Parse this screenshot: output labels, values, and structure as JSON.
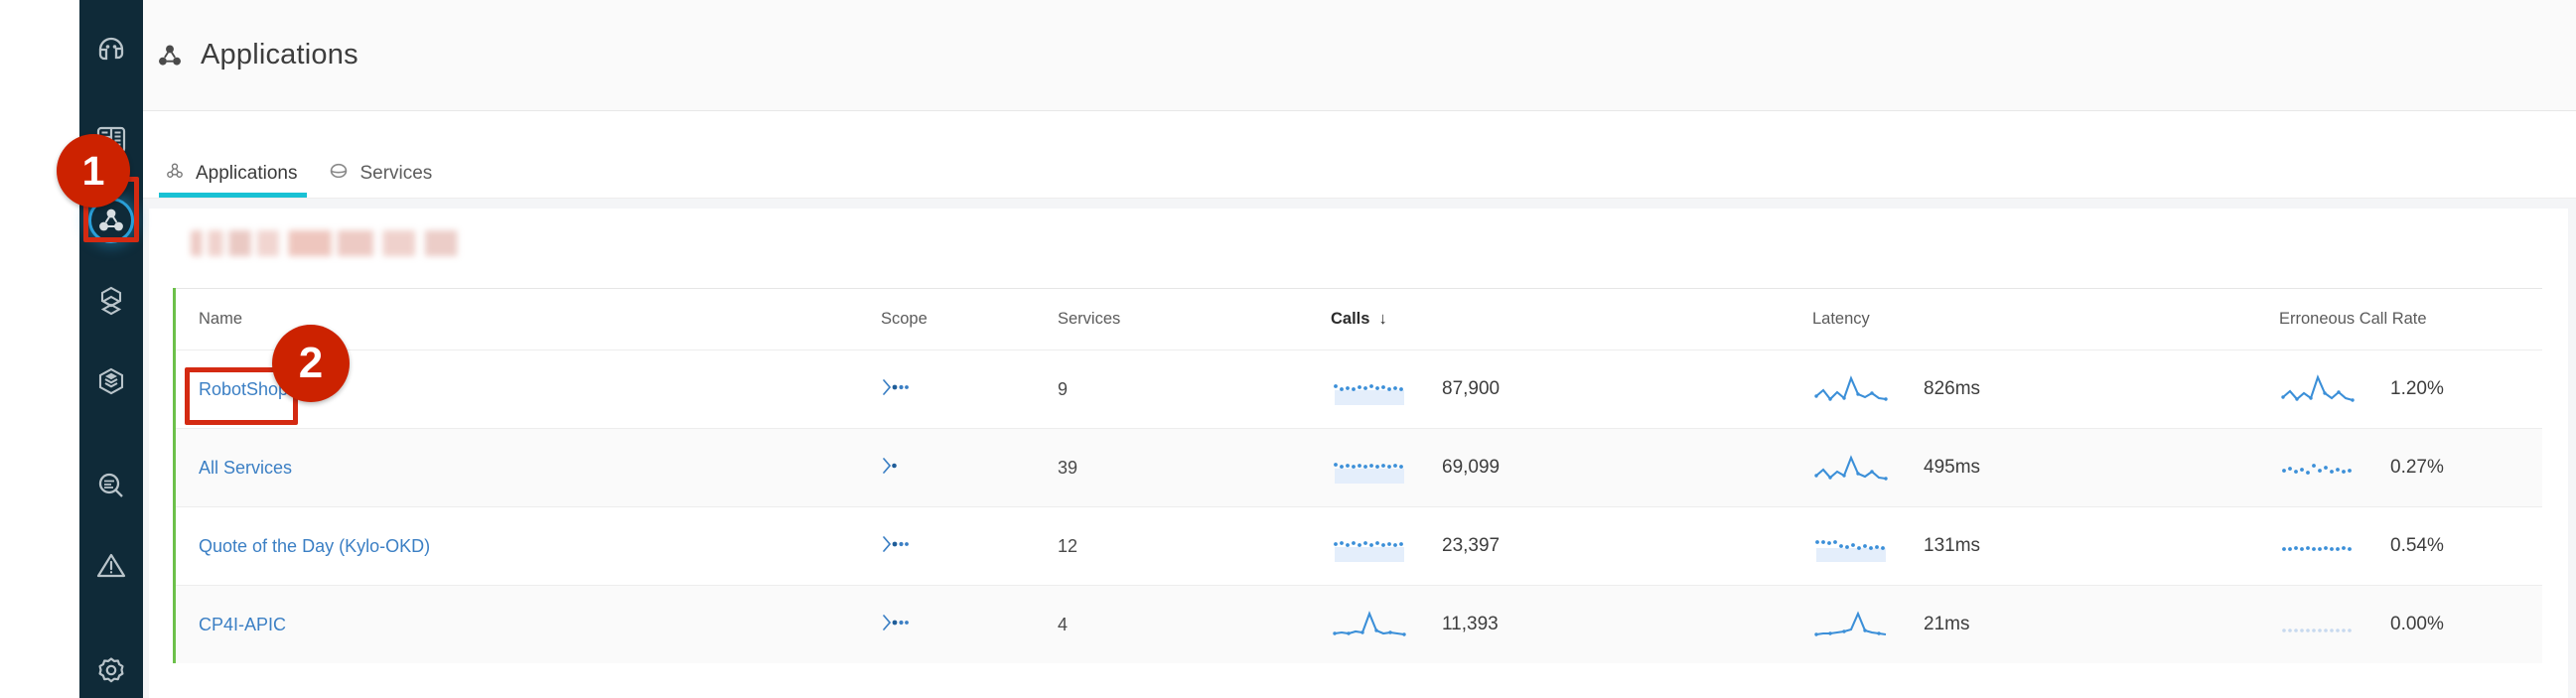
{
  "sidebar": {
    "items": [
      {
        "name": "home-icon",
        "label": "Home",
        "active": false
      },
      {
        "name": "dashboard-icon",
        "label": "Dashboards",
        "active": false
      },
      {
        "name": "applications-icon",
        "label": "Applications",
        "active": true
      },
      {
        "name": "services-icon",
        "label": "Services",
        "active": false
      },
      {
        "name": "stack-icon",
        "label": "Infrastructure",
        "active": false
      },
      {
        "name": "search-icon",
        "label": "Analytics",
        "active": false
      },
      {
        "name": "alert-icon",
        "label": "Events",
        "active": false
      },
      {
        "name": "settings-icon",
        "label": "Settings",
        "active": false
      }
    ]
  },
  "header": {
    "title": "Applications",
    "icon": "applications-icon"
  },
  "tabs": [
    {
      "label": "Applications",
      "icon": "applications-icon",
      "active": true
    },
    {
      "label": "Services",
      "icon": "service-icon",
      "active": false
    }
  ],
  "table": {
    "columns": [
      {
        "key": "name",
        "label": "Name",
        "sorted": false
      },
      {
        "key": "scope",
        "label": "Scope",
        "sorted": false
      },
      {
        "key": "services",
        "label": "Services",
        "sorted": false
      },
      {
        "key": "calls",
        "label": "Calls",
        "sorted": true,
        "sort_dir": "↓"
      },
      {
        "key": "latency",
        "label": "Latency",
        "sorted": false
      },
      {
        "key": "error",
        "label": "Erroneous Call Rate",
        "sorted": false
      }
    ],
    "rows": [
      {
        "name": "RobotShop",
        "scope_icon": "scope-filter-icon",
        "services": "9",
        "calls": "87,900",
        "latency": "826ms",
        "error": "1.20%"
      },
      {
        "name": "All Services",
        "scope_icon": "scope-filter-simple-icon",
        "services": "39",
        "calls": "69,099",
        "latency": "495ms",
        "error": "0.27%"
      },
      {
        "name": "Quote of the Day (Kylo-OKD)",
        "scope_icon": "scope-filter-icon",
        "services": "12",
        "calls": "23,397",
        "latency": "131ms",
        "error": "0.54%"
      },
      {
        "name": "CP4I-APIC",
        "scope_icon": "scope-filter-icon",
        "services": "4",
        "calls": "11,393",
        "latency": "21ms",
        "error": "0.00%"
      }
    ]
  },
  "annotations": {
    "badge1": "1",
    "badge2": "2"
  },
  "colors": {
    "sidebar_bg": "#0f2a38",
    "accent_tab": "#19c1d4",
    "link": "#3b7fc4",
    "annotation_red": "#cc2200",
    "table_left_border": "#6cc04a",
    "spark_blue": "#3b8fd8"
  },
  "chart_data": [
    {
      "type": "line",
      "name": "calls-sparkline-robotshop",
      "values": [
        42,
        48,
        52,
        46,
        55,
        60,
        58,
        62,
        57,
        61,
        64,
        59,
        63,
        66
      ],
      "ylabel": "Calls",
      "label": "87,900"
    },
    {
      "type": "line",
      "name": "latency-sparkline-robotshop",
      "values": [
        20,
        32,
        14,
        26,
        18,
        88,
        40,
        22,
        30,
        16,
        24,
        18,
        14,
        12
      ],
      "ylabel": "Latency",
      "label": "826ms"
    },
    {
      "type": "line",
      "name": "error-sparkline-robotshop",
      "values": [
        18,
        26,
        12,
        22,
        16,
        86,
        38,
        20,
        34,
        18,
        22,
        14,
        12,
        10
      ],
      "ylabel": "Error",
      "label": "1.20%"
    },
    {
      "type": "line",
      "name": "calls-sparkline-allservices",
      "values": [
        40,
        46,
        50,
        48,
        54,
        58,
        56,
        60,
        57,
        62,
        60,
        63,
        61,
        64
      ],
      "ylabel": "Calls",
      "label": "69,099"
    },
    {
      "type": "line",
      "name": "latency-sparkline-allservices",
      "values": [
        22,
        34,
        16,
        28,
        20,
        84,
        44,
        24,
        32,
        18,
        26,
        20,
        16,
        14
      ],
      "ylabel": "Latency",
      "label": "495ms"
    },
    {
      "type": "line",
      "name": "error-sparkline-allservices",
      "values": [
        30,
        36,
        28,
        34,
        26,
        40,
        34,
        46,
        30,
        38,
        28,
        34,
        30,
        32
      ],
      "ylabel": "Error",
      "label": "0.27%"
    },
    {
      "type": "line",
      "name": "calls-sparkline-qotd",
      "values": [
        50,
        54,
        48,
        56,
        52,
        58,
        50,
        60,
        54,
        62,
        56,
        58,
        52,
        60
      ],
      "ylabel": "Calls",
      "label": "23,397"
    },
    {
      "type": "line",
      "name": "latency-sparkline-qotd",
      "values": [
        56,
        58,
        54,
        60,
        50,
        44,
        52,
        38,
        48,
        34,
        46,
        40,
        42,
        38
      ],
      "ylabel": "Latency",
      "label": "131ms"
    },
    {
      "type": "line",
      "name": "error-sparkline-qotd",
      "values": [
        32,
        34,
        30,
        36,
        32,
        34,
        30,
        36,
        32,
        34,
        30,
        32,
        30,
        34
      ],
      "ylabel": "Error",
      "label": "0.54%"
    },
    {
      "type": "line",
      "name": "calls-sparkline-cp4i",
      "values": [
        16,
        20,
        18,
        22,
        20,
        90,
        34,
        22,
        26,
        20,
        24,
        18,
        20,
        16
      ],
      "ylabel": "Calls",
      "label": "11,393"
    },
    {
      "type": "line",
      "name": "latency-sparkline-cp4i",
      "values": [
        14,
        16,
        18,
        22,
        26,
        30,
        88,
        34,
        26,
        22,
        20,
        18,
        16,
        14
      ],
      "ylabel": "Latency",
      "label": "21ms"
    },
    {
      "type": "line",
      "name": "error-sparkline-cp4i",
      "values": [
        2,
        2,
        2,
        2,
        2,
        2,
        2,
        2,
        2,
        2,
        2,
        2,
        2,
        2
      ],
      "ylabel": "Error",
      "label": "0.00%"
    }
  ]
}
